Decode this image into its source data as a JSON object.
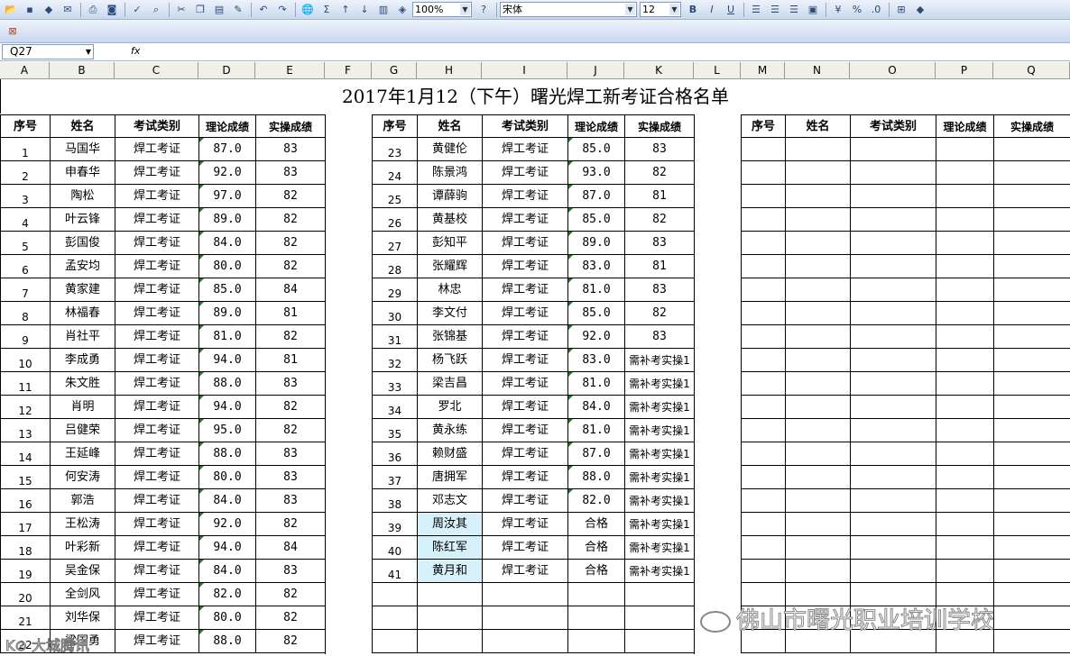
{
  "toolbar": {
    "zoom": "100%",
    "font_name": "宋体",
    "font_size": "12",
    "sigma": "Σ",
    "percent": "%"
  },
  "formula_bar": {
    "name_box": "Q27",
    "fx": "fx"
  },
  "columns": [
    "A",
    "B",
    "C",
    "D",
    "E",
    "F",
    "G",
    "H",
    "I",
    "J",
    "K",
    "L",
    "M",
    "N",
    "O",
    "P",
    "Q"
  ],
  "sheet": {
    "title": "2017年1月12（下午）曙光焊工新考证合格名单",
    "headers": [
      "序号",
      "姓名",
      "考试类别",
      "理论成绩",
      "实操成绩"
    ],
    "left_rows": [
      {
        "no": "1",
        "name": "马国华",
        "type": "焊工考证",
        "theory": "87.0",
        "practice": "83"
      },
      {
        "no": "2",
        "name": "申春华",
        "type": "焊工考证",
        "theory": "92.0",
        "practice": "83"
      },
      {
        "no": "3",
        "name": "陶松",
        "type": "焊工考证",
        "theory": "97.0",
        "practice": "82"
      },
      {
        "no": "4",
        "name": "叶云锋",
        "type": "焊工考证",
        "theory": "89.0",
        "practice": "82"
      },
      {
        "no": "5",
        "name": "彭国俊",
        "type": "焊工考证",
        "theory": "84.0",
        "practice": "82"
      },
      {
        "no": "6",
        "name": "孟安均",
        "type": "焊工考证",
        "theory": "80.0",
        "practice": "82"
      },
      {
        "no": "7",
        "name": "黄家建",
        "type": "焊工考证",
        "theory": "85.0",
        "practice": "84"
      },
      {
        "no": "8",
        "name": "林福春",
        "type": "焊工考证",
        "theory": "89.0",
        "practice": "81"
      },
      {
        "no": "9",
        "name": "肖社平",
        "type": "焊工考证",
        "theory": "81.0",
        "practice": "82"
      },
      {
        "no": "10",
        "name": "李成勇",
        "type": "焊工考证",
        "theory": "94.0",
        "practice": "81"
      },
      {
        "no": "11",
        "name": "朱文胜",
        "type": "焊工考证",
        "theory": "88.0",
        "practice": "83"
      },
      {
        "no": "12",
        "name": "肖明",
        "type": "焊工考证",
        "theory": "94.0",
        "practice": "82"
      },
      {
        "no": "13",
        "name": "吕健荣",
        "type": "焊工考证",
        "theory": "95.0",
        "practice": "82"
      },
      {
        "no": "14",
        "name": "王延峰",
        "type": "焊工考证",
        "theory": "88.0",
        "practice": "83"
      },
      {
        "no": "15",
        "name": "何安涛",
        "type": "焊工考证",
        "theory": "80.0",
        "practice": "83"
      },
      {
        "no": "16",
        "name": "郭浩",
        "type": "焊工考证",
        "theory": "84.0",
        "practice": "83"
      },
      {
        "no": "17",
        "name": "王松涛",
        "type": "焊工考证",
        "theory": "92.0",
        "practice": "82"
      },
      {
        "no": "18",
        "name": "叶彩新",
        "type": "焊工考证",
        "theory": "94.0",
        "practice": "84"
      },
      {
        "no": "19",
        "name": "吴金保",
        "type": "焊工考证",
        "theory": "84.0",
        "practice": "83"
      },
      {
        "no": "20",
        "name": "全剑风",
        "type": "焊工考证",
        "theory": "82.0",
        "practice": "82"
      },
      {
        "no": "21",
        "name": "刘华保",
        "type": "焊工考证",
        "theory": "80.0",
        "practice": "82"
      },
      {
        "no": "22",
        "name": "梁国勇",
        "type": "焊工考证",
        "theory": "88.0",
        "practice": "82"
      }
    ],
    "mid_rows": [
      {
        "no": "23",
        "name": "黄健伦",
        "type": "焊工考证",
        "theory": "85.0",
        "practice": "83"
      },
      {
        "no": "24",
        "name": "陈景鸿",
        "type": "焊工考证",
        "theory": "93.0",
        "practice": "82"
      },
      {
        "no": "25",
        "name": "谭薛驹",
        "type": "焊工考证",
        "theory": "87.0",
        "practice": "81"
      },
      {
        "no": "26",
        "name": "黄基校",
        "type": "焊工考证",
        "theory": "85.0",
        "practice": "82"
      },
      {
        "no": "27",
        "name": "彭知平",
        "type": "焊工考证",
        "theory": "89.0",
        "practice": "83"
      },
      {
        "no": "28",
        "name": "张耀辉",
        "type": "焊工考证",
        "theory": "83.0",
        "practice": "81"
      },
      {
        "no": "29",
        "name": "林忠",
        "type": "焊工考证",
        "theory": "81.0",
        "practice": "83"
      },
      {
        "no": "30",
        "name": "李文付",
        "type": "焊工考证",
        "theory": "85.0",
        "practice": "82"
      },
      {
        "no": "31",
        "name": "张锦基",
        "type": "焊工考证",
        "theory": "92.0",
        "practice": "83"
      },
      {
        "no": "32",
        "name": "杨飞跃",
        "type": "焊工考证",
        "theory": "83.0",
        "practice": "需补考实操1"
      },
      {
        "no": "33",
        "name": "梁吉昌",
        "type": "焊工考证",
        "theory": "81.0",
        "practice": "需补考实操1"
      },
      {
        "no": "34",
        "name": "罗北",
        "type": "焊工考证",
        "theory": "84.0",
        "practice": "需补考实操1"
      },
      {
        "no": "35",
        "name": "黄永练",
        "type": "焊工考证",
        "theory": "81.0",
        "practice": "需补考实操1"
      },
      {
        "no": "36",
        "name": "赖财盛",
        "type": "焊工考证",
        "theory": "87.0",
        "practice": "需补考实操1"
      },
      {
        "no": "37",
        "name": "唐拥军",
        "type": "焊工考证",
        "theory": "88.0",
        "practice": "需补考实操1"
      },
      {
        "no": "38",
        "name": "邓志文",
        "type": "焊工考证",
        "theory": "82.0",
        "practice": "需补考实操1"
      },
      {
        "no": "39",
        "name": "周汝其",
        "type": "焊工考证",
        "theory": "合格",
        "practice": "需补考实操1"
      },
      {
        "no": "40",
        "name": "陈红军",
        "type": "焊工考证",
        "theory": "合格",
        "practice": "需补考实操1"
      },
      {
        "no": "41",
        "name": "黄月和",
        "type": "焊工考证",
        "theory": "合格",
        "practice": "需补考实操1"
      }
    ],
    "watermark": "佛山市曙光职业培训学校",
    "corner_watermark": "K⊙ 大城腾讯"
  },
  "colors": {
    "grid": "#000000",
    "header_bg": "#f0f0e8",
    "highlight": "#d7f1fb",
    "comment_marker": "#1a7a2a"
  }
}
